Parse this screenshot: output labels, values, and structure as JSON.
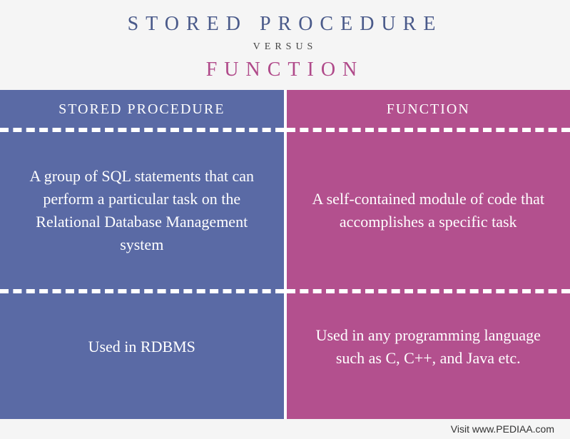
{
  "header": {
    "title1": "STORED PROCEDURE",
    "versus": "VERSUS",
    "title2": "FUNCTION"
  },
  "left": {
    "heading": "STORED PROCEDURE",
    "definition": "A group of SQL statements that can perform a particular task on the Relational Database Management system",
    "usage": "Used in RDBMS"
  },
  "right": {
    "heading": "FUNCTION",
    "definition": "A self-contained module of code that accomplishes a specific task",
    "usage": "Used in any programming language such as C, C++, and Java etc."
  },
  "footer": {
    "text": "Visit www.PEDIAA.com"
  }
}
